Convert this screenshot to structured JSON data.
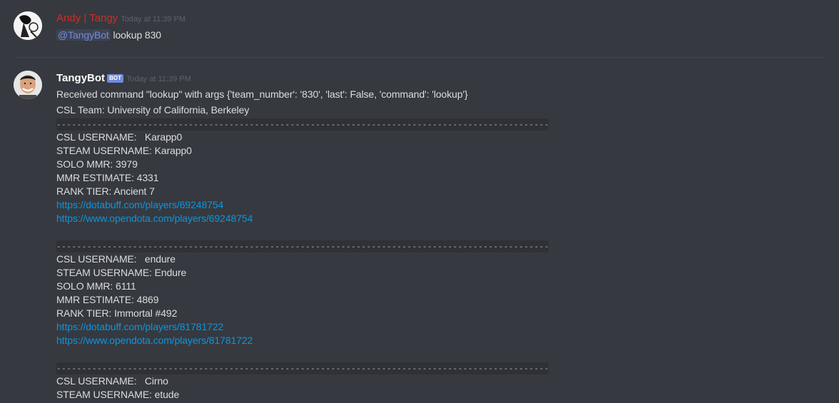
{
  "colors": {
    "background": "#36393f",
    "text": "#dcddde",
    "link": "#0b96e0",
    "user_name": "#c4312b",
    "bot_name": "#ffffff",
    "mention": "#7289da",
    "timestamp": "#5e6268"
  },
  "message1": {
    "username": "Andy | Tangy",
    "timestamp": "Today at 11:39 PM",
    "mention": "@TangyBot",
    "text": " lookup 830"
  },
  "message2": {
    "username": "TangyBot",
    "bot_tag": "BOT",
    "timestamp": "Today at 11:39 PM",
    "received": "Received command \"lookup\" with args {'team_number': '830', 'last': False, 'command': 'lookup'}",
    "team": "CSL Team: University of California, Berkeley",
    "separator": "----------------------------------------------------------------------------------------------------------",
    "players": [
      {
        "csl": "CSL USERNAME:   Karapp0",
        "steam": "STEAM USERNAME: Karapp0",
        "solo": "SOLO MMR: 3979",
        "mmr": "MMR ESTIMATE: 4331",
        "rank": "RANK TIER: Ancient 7",
        "link1": "https://dotabuff.com/players/69248754",
        "link2": "https://www.opendota.com/players/69248754"
      },
      {
        "csl": "CSL USERNAME:   endure",
        "steam": "STEAM USERNAME: Endure",
        "solo": "SOLO MMR: 6111",
        "mmr": "MMR ESTIMATE: 4869",
        "rank": "RANK TIER: Immortal #492",
        "link1": "https://dotabuff.com/players/81781722",
        "link2": "https://www.opendota.com/players/81781722"
      },
      {
        "csl": "CSL USERNAME:   Cirno",
        "steam": "STEAM USERNAME: etude"
      }
    ]
  }
}
